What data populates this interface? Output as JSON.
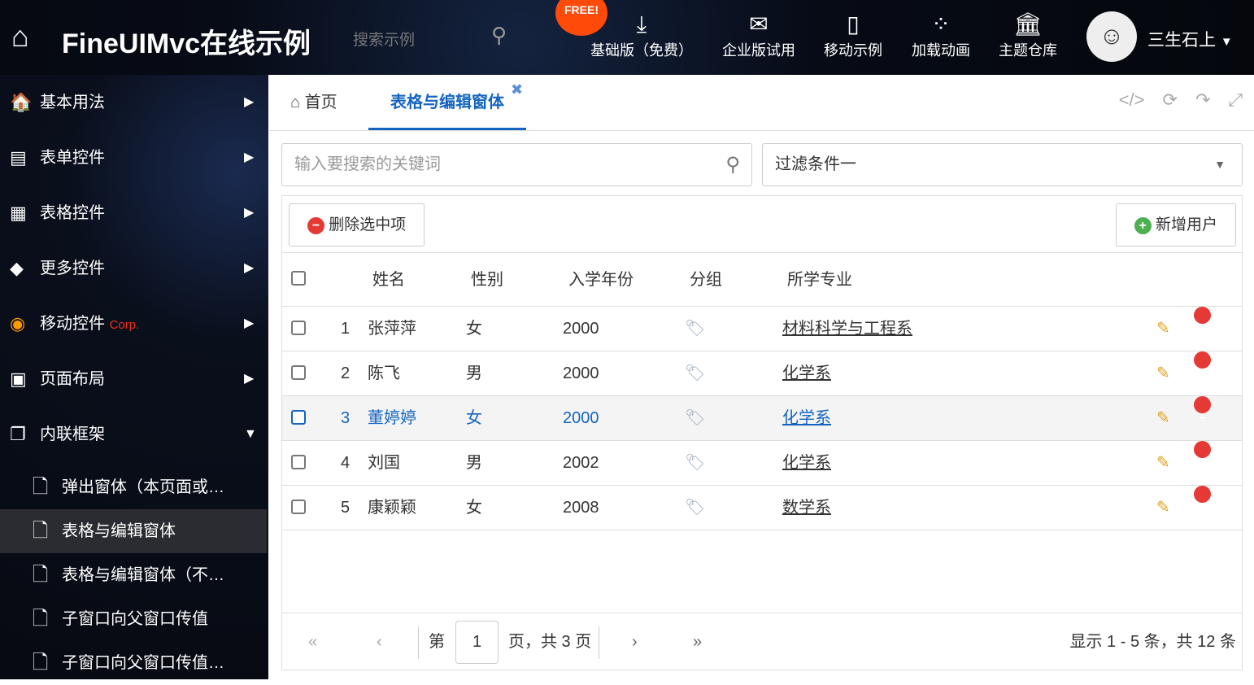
{
  "header": {
    "title": "FineUIMvc在线示例",
    "search_placeholder": "搜索示例",
    "free_badge": "FREE!",
    "nav": [
      {
        "label": "基础版（免费）",
        "icon": "download-icon"
      },
      {
        "label": "企业版试用",
        "icon": "envelope-icon"
      },
      {
        "label": "移动示例",
        "icon": "mobile-icon"
      },
      {
        "label": "加载动画",
        "icon": "spinner-icon"
      },
      {
        "label": "主题仓库",
        "icon": "bank-icon"
      }
    ],
    "user": "三生石上"
  },
  "sidebar": {
    "items": [
      {
        "label": "基本用法"
      },
      {
        "label": "表单控件"
      },
      {
        "label": "表格控件"
      },
      {
        "label": "更多控件"
      },
      {
        "label": "移动控件",
        "badge": "Corp."
      },
      {
        "label": "页面布局"
      },
      {
        "label": "内联框架"
      }
    ],
    "subitems": [
      {
        "label": "弹出窗体（本页面或…"
      },
      {
        "label": "表格与编辑窗体"
      },
      {
        "label": "表格与编辑窗体（不…"
      },
      {
        "label": "子窗口向父窗口传值"
      },
      {
        "label": "子窗口向父窗口传值…"
      }
    ]
  },
  "tabs": [
    {
      "label": "首页"
    },
    {
      "label": "表格与编辑窗体"
    }
  ],
  "filter": {
    "search_placeholder": "输入要搜索的关键词",
    "select_value": "过滤条件一"
  },
  "toolbar": {
    "delete_label": "删除选中项",
    "add_label": "新增用户"
  },
  "grid": {
    "columns": [
      "姓名",
      "性别",
      "入学年份",
      "分组",
      "所学专业"
    ],
    "rows": [
      {
        "n": "1",
        "name": "张萍萍",
        "gender": "女",
        "year": "2000",
        "major": "材料科学与工程系"
      },
      {
        "n": "2",
        "name": "陈飞",
        "gender": "男",
        "year": "2000",
        "major": "化学系"
      },
      {
        "n": "3",
        "name": "董婷婷",
        "gender": "女",
        "year": "2000",
        "major": "化学系"
      },
      {
        "n": "4",
        "name": "刘国",
        "gender": "男",
        "year": "2002",
        "major": "化学系"
      },
      {
        "n": "5",
        "name": "康颖颖",
        "gender": "女",
        "year": "2008",
        "major": "数学系"
      }
    ]
  },
  "pager": {
    "page_prefix": "第",
    "page": "1",
    "page_suffix": "页，共 3 页",
    "summary": "显示 1 - 5 条，共 12 条"
  }
}
